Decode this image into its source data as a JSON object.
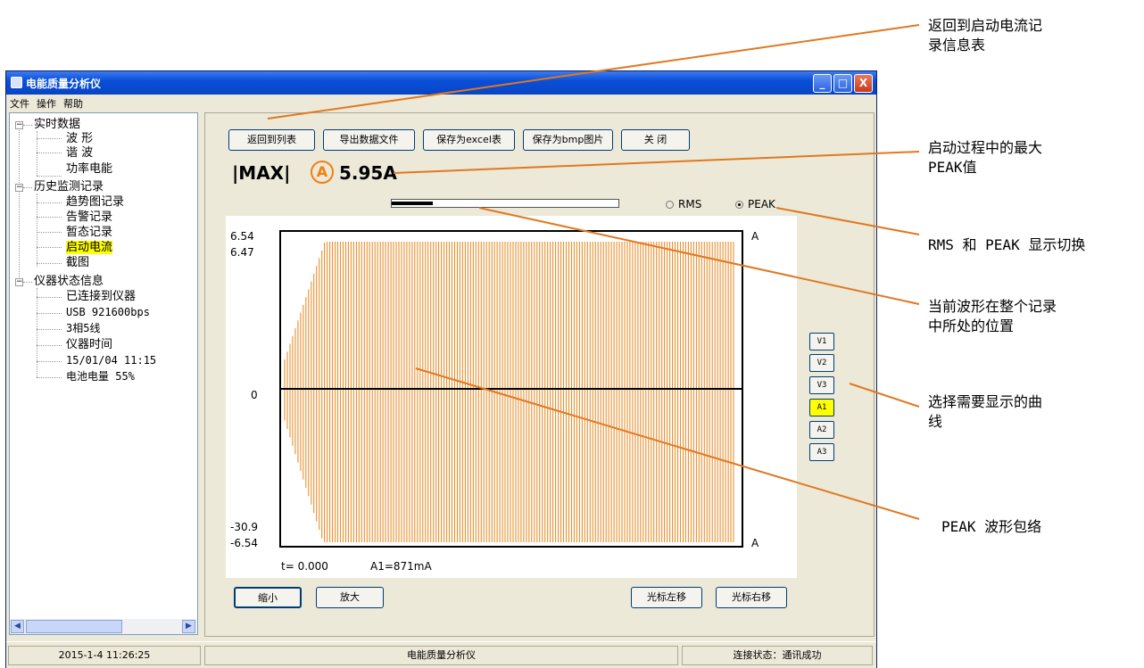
{
  "window": {
    "title": "电能质量分析仪",
    "buttons": {
      "minimize": "_",
      "maximize": "□",
      "close": "X"
    }
  },
  "menu": [
    "文件",
    "操作",
    "帮助"
  ],
  "tree": {
    "groups": [
      {
        "label": "实时数据",
        "expander": "−",
        "items": [
          "波 形",
          "谐 波",
          "功率电能"
        ]
      },
      {
        "label": "历史监测记录",
        "expander": "−",
        "items": [
          "趋势图记录",
          "告警记录",
          "暂态记录",
          "启动电流",
          "截图"
        ],
        "selected_index": 3
      },
      {
        "label": "仪器状态信息",
        "expander": "−",
        "items": [
          "已连接到仪器",
          "USB 921600bps",
          "3相5线",
          "仪器时间",
          "15/01/04 11:15",
          "电池电量 55%"
        ]
      }
    ]
  },
  "toolbar": {
    "back": "返回到列表",
    "export": "导出数据文件",
    "save_excel": "保存为excel表",
    "save_bmp": "保存为bmp图片",
    "close": "关 闭"
  },
  "max_display": {
    "label": "|MAX|",
    "unit_icon": "A",
    "value": "5.95A"
  },
  "position_fraction": 0.18,
  "mode": {
    "rms": "RMS",
    "peak": "PEAK",
    "selected": "PEAK"
  },
  "chart_data": {
    "type": "line",
    "series": [
      {
        "name": "A1",
        "color": "#e89030"
      }
    ],
    "y_left_labels_top": [
      "6.54",
      "6.47"
    ],
    "y_left_label_zero": "0",
    "y_left_labels_bottom": [
      "-30.9",
      "-6.54"
    ],
    "unit_top": "A",
    "unit_bottom": "A",
    "ylim": [
      -6.54,
      6.54
    ],
    "cursor_time": "t= 0.000",
    "cursor_value": "A1=871mA"
  },
  "channels": [
    "V1",
    "V2",
    "V3",
    "A1",
    "A2",
    "A3"
  ],
  "active_channel": "A1",
  "bottom_buttons": {
    "zoom_out": "缩小",
    "zoom_in": "放大",
    "cursor_left": "光标左移",
    "cursor_right": "光标右移"
  },
  "status": {
    "datetime": "2015-1-4 11:26:25",
    "app": "电能质量分析仪",
    "connection": "连接状态：通讯成功"
  },
  "annotations": {
    "back": [
      "返回到启动电流记",
      "录信息表"
    ],
    "max_peak": [
      "启动过程中的最大",
      "PEAK值"
    ],
    "toggle": [
      "RMS 和 PEAK 显示切换"
    ],
    "position": [
      "当前波形在整个记录",
      "中所处的位置"
    ],
    "select": [
      "选择需要显示的曲",
      "线"
    ],
    "envelope": [
      "PEAK 波形包络"
    ]
  },
  "colors": {
    "accent": "#e07820",
    "selected": "#ffff00",
    "waveform": "#e89030"
  }
}
